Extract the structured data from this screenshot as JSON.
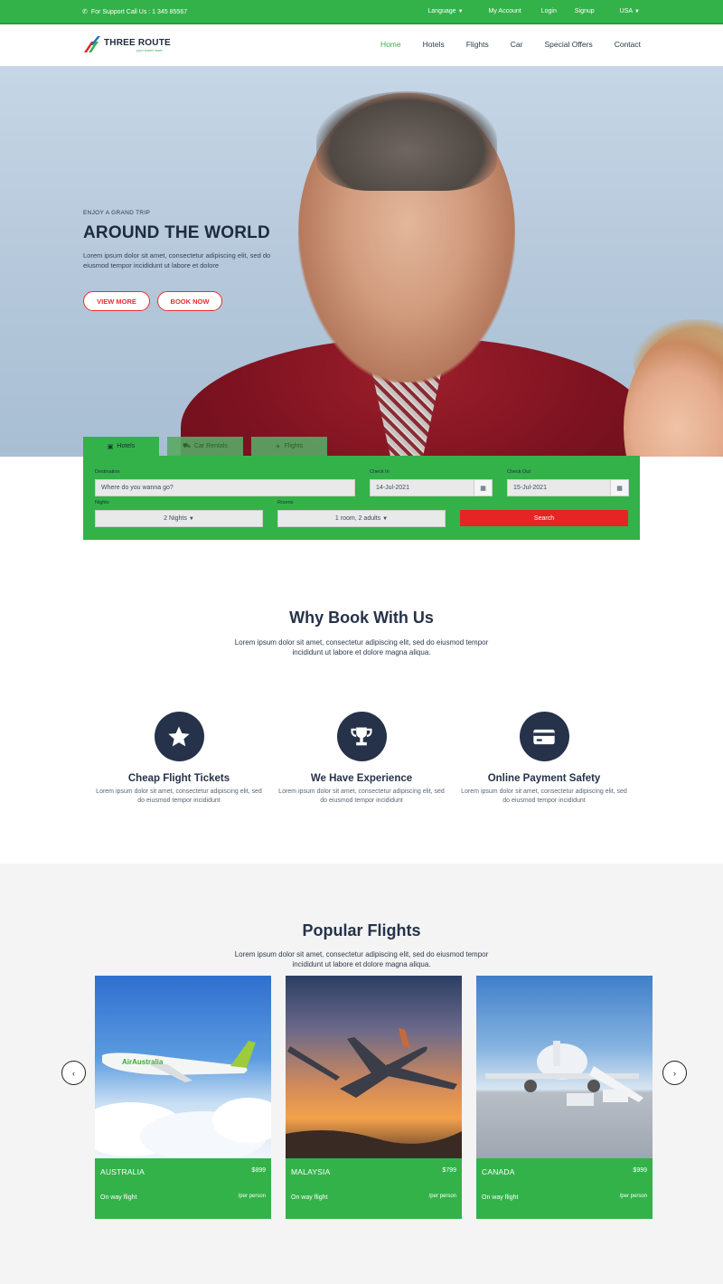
{
  "topbar": {
    "support": "For Support Call Us : 1 345 85567",
    "language": "Language",
    "my_account": "My Account",
    "login": "Login",
    "signup": "Signup",
    "country": "USA"
  },
  "header": {
    "logo_name": "THREE ROUTE",
    "logo_tag": "your travel mate",
    "nav": [
      "Home",
      "Hotels",
      "Flights",
      "Car",
      "Special Offers",
      "Contact"
    ]
  },
  "hero": {
    "kicker": "ENJOY A GRAND TRIP",
    "title": "AROUND THE WORLD",
    "desc": "Lorem ipsum dolor sit amet, consectetur adipiscing elit, sed do eiusmod tempor incididunt ut labore et dolore",
    "view_more": "VIEW MORE",
    "book_now": "BOOK NOW"
  },
  "search": {
    "tabs": [
      "Hotels",
      "Car Rentals",
      "Flights"
    ],
    "destination_label": "Destination",
    "destination_placeholder": "Where do you wanna go?",
    "checkin_label": "Check In",
    "checkin_value": "14-Jul-2021",
    "checkout_label": "Check Out",
    "checkout_value": "15-Jul-2021",
    "nights_label": "Nights",
    "nights_value": "2 Nights",
    "rooms_label": "Rooms",
    "rooms_value": "1 room, 2 adults",
    "search_button": "Search"
  },
  "why": {
    "title": "Why Book With Us",
    "desc": "Lorem ipsum dolor sit amet, consectetur adipiscing elit, sed do eiusmod tempor incididunt ut labore et dolore magna aliqua.",
    "features": [
      {
        "title": "Cheap Flight Tickets",
        "desc": "Lorem ipsum dolor sit amet, consectetur adipiscing elit, sed do eiusmod tempor incididunt"
      },
      {
        "title": "We Have Experience",
        "desc": "Lorem ipsum dolor sit amet, consectetur adipiscing elit, sed do eiusmod tempor incididunt"
      },
      {
        "title": "Online Payment Safety",
        "desc": "Lorem ipsum dolor sit amet, consectetur adipiscing elit, sed do eiusmod tempor incididunt"
      }
    ]
  },
  "popular": {
    "title": "Popular Flights",
    "desc": "Lorem ipsum dolor sit amet, consectetur adipiscing elit, sed do eiusmod tempor incididunt ut labore et dolore magna aliqua.",
    "cards": [
      {
        "country": "AUSTRALIA",
        "price": "$899",
        "way": "On way flight",
        "per": "/per person"
      },
      {
        "country": "MALAYSIA",
        "price": "$799",
        "way": "On way flight",
        "per": "/per person"
      },
      {
        "country": "CANADA",
        "price": "$999",
        "way": "On way flight",
        "per": "/per person"
      }
    ]
  },
  "colors": {
    "brand_green": "#33b249",
    "accent_red": "#e62424",
    "navy": "#26324a"
  }
}
